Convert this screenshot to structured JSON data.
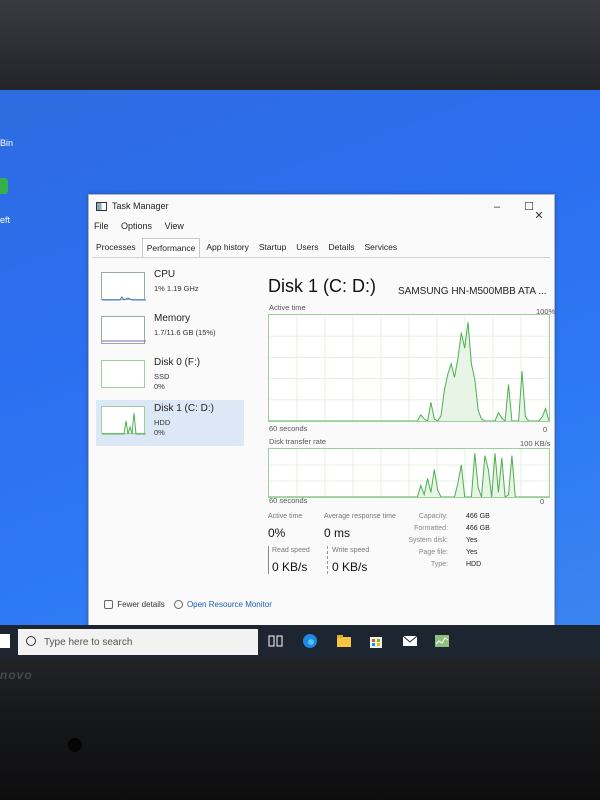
{
  "desktop": {
    "label_top": "Bin",
    "label_mid": "eft"
  },
  "window": {
    "title": "Task Manager",
    "controls": {
      "minimize": "–",
      "maximize": "☐",
      "close": "✕"
    }
  },
  "menu": [
    "File",
    "Options",
    "View"
  ],
  "tabs": [
    "Processes",
    "Performance",
    "App history",
    "Startup",
    "Users",
    "Details",
    "Services"
  ],
  "devices": [
    {
      "name": "CPU",
      "line2": "1% 1.19 GHz",
      "line3": ""
    },
    {
      "name": "Memory",
      "line2": "1.7/11.6 GB (15%)",
      "line3": ""
    },
    {
      "name": "Disk 0 (F:)",
      "line2": "SSD",
      "line3": "0%"
    },
    {
      "name": "Disk 1 (C: D:)",
      "line2": "HDD",
      "line3": "0%"
    }
  ],
  "disk": {
    "title": "Disk 1 (C: D:)",
    "model": "SAMSUNG HN-M500MBB ATA ...",
    "active_time_label": "Active time",
    "active_time_max": "100%",
    "graph1_seconds": "60 seconds",
    "graph1_min": "0",
    "transfer_label": "Disk transfer rate",
    "transfer_max": "100 KB/s",
    "graph2_seconds": "60 seconds",
    "graph2_min": "0"
  },
  "stats": {
    "active_time": {
      "label": "Active time",
      "value": "0%"
    },
    "avg_response": {
      "label": "Average response time",
      "value": "0 ms"
    },
    "read_speed": {
      "label": "Read speed",
      "value": "0 KB/s"
    },
    "write_speed": {
      "label": "Write speed",
      "value": "0 KB/s"
    }
  },
  "properties": [
    {
      "key": "Capacity:",
      "value": "466 GB"
    },
    {
      "key": "Formatted:",
      "value": "466 GB"
    },
    {
      "key": "System disk:",
      "value": "Yes"
    },
    {
      "key": "Page file:",
      "value": "Yes"
    },
    {
      "key": "Type:",
      "value": "HDD"
    }
  ],
  "footer": {
    "fewer_details": "Fewer details",
    "open_resource_monitor": "Open Resource Monitor"
  },
  "taskbar": {
    "search_placeholder": "Type here to search"
  },
  "brand": "novo",
  "colors": {
    "desktop_blue": "#2b6ff0",
    "graph_green": "#4caf50",
    "selected_row": "#dce8f5",
    "link_blue": "#1a5fb4"
  },
  "graphs": {
    "active_time_percent": [
      0,
      0,
      0,
      0,
      0,
      0,
      0,
      0,
      0,
      0,
      0,
      0,
      0,
      0,
      0,
      0,
      0,
      0,
      0,
      0,
      0,
      0,
      0,
      0,
      0,
      0,
      0,
      0,
      0,
      0,
      0,
      0,
      0,
      0,
      0,
      0,
      0,
      0,
      0,
      0,
      0,
      0,
      0,
      0,
      0,
      6,
      2,
      0,
      18,
      2,
      0,
      5,
      30,
      45,
      55,
      42,
      60,
      85,
      70,
      95,
      55,
      40,
      10,
      2,
      0,
      0,
      0,
      0,
      8,
      3,
      0,
      35,
      0,
      0,
      0,
      48,
      4,
      0,
      0,
      0,
      0,
      4,
      12,
      0
    ],
    "transfer_percent": [
      0,
      0,
      0,
      0,
      0,
      0,
      0,
      0,
      0,
      0,
      0,
      0,
      0,
      0,
      0,
      0,
      0,
      0,
      0,
      0,
      0,
      0,
      0,
      0,
      0,
      0,
      0,
      0,
      0,
      0,
      0,
      0,
      0,
      0,
      0,
      0,
      0,
      0,
      0,
      0,
      0,
      0,
      0,
      0,
      0,
      25,
      5,
      40,
      10,
      60,
      15,
      0,
      0,
      0,
      0,
      0,
      30,
      70,
      0,
      0,
      0,
      95,
      20,
      0,
      90,
      60,
      0,
      95,
      10,
      85,
      0,
      5,
      90,
      0,
      0,
      0,
      0,
      0,
      0,
      0,
      0,
      0,
      0,
      0
    ]
  }
}
